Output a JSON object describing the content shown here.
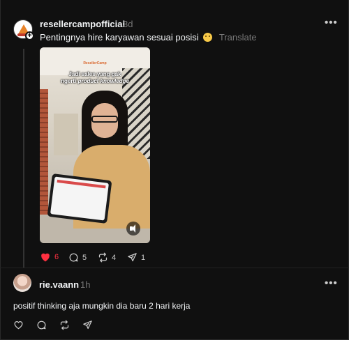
{
  "post": {
    "username": "resellercampofficial",
    "time": "3d",
    "text": "Pentingnya hire karyawan sesuai posisi",
    "emoji_icon": "persevering-face-emoji",
    "translate_label": "Translate",
    "more_label": "•••",
    "follow_label": "+",
    "media": {
      "brand": "ResellerCamp",
      "caption_line1": "Jadi sales yang gak",
      "caption_line2_plain": "ngerti",
      "caption_line2_emph": "product knowledge"
    },
    "actions": {
      "likes": "6",
      "comments": "5",
      "reposts": "4",
      "shares": "1",
      "like_color": "#ff3040"
    }
  },
  "reply": {
    "username": "rie.vaann",
    "time": "1h",
    "text": "positif thinking aja mungkin dia baru 2 hari kerja",
    "more_label": "•••"
  }
}
